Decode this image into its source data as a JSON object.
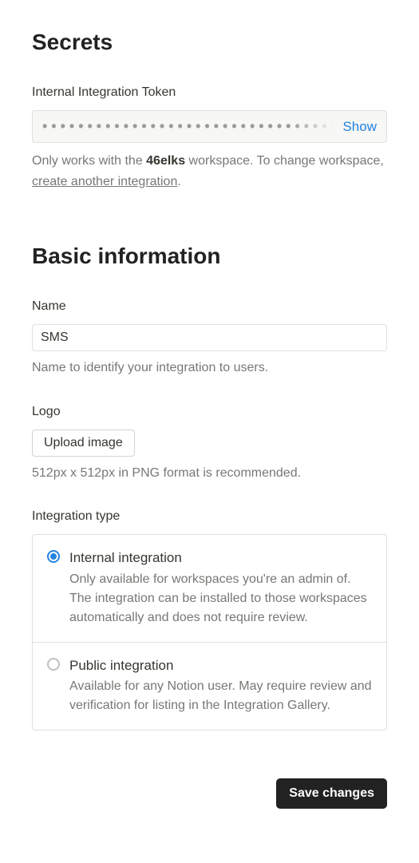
{
  "secrets": {
    "heading": "Secrets",
    "token_label": "Internal Integration Token",
    "token_dots": "•••••••••••••••••••••••••••••••••••••••••••",
    "show_label": "Show",
    "help_prefix": "Only works with the ",
    "help_workspace": "46elks",
    "help_mid": " workspace. To change workspace, ",
    "help_link": "create another integration",
    "help_suffix": "."
  },
  "basic": {
    "heading": "Basic information",
    "name_label": "Name",
    "name_value": "SMS",
    "name_help": "Name to identify your integration to users.",
    "logo_label": "Logo",
    "upload_label": "Upload image",
    "logo_help": "512px x 512px in PNG format is recommended.",
    "type_label": "Integration type",
    "options": [
      {
        "title": "Internal integration",
        "desc": "Only available for workspaces you're an admin of. The integration can be installed to those workspaces automatically and does not require review.",
        "selected": true
      },
      {
        "title": "Public integration",
        "desc": "Available for any Notion user. May require review and verification for listing in the Integration Gallery.",
        "selected": false
      }
    ]
  },
  "actions": {
    "save": "Save changes"
  }
}
